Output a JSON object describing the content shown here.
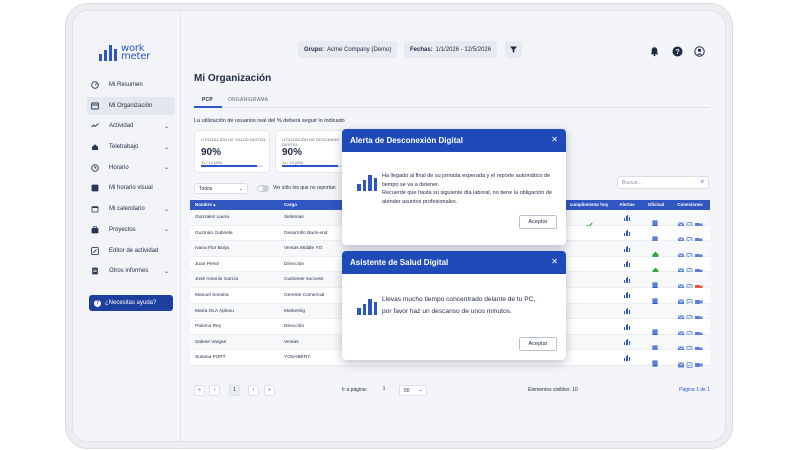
{
  "window_controls": {
    "colors": [
      "#ef5f58",
      "#f7bf2f",
      "#3ec44e"
    ]
  },
  "logo": {
    "line1": "work",
    "line2": "meter",
    "brand_color": "#2c56c4"
  },
  "sidebar": {
    "items": [
      {
        "label": "Mi Resumen",
        "icon": "dashboard-icon",
        "has_chevron": false,
        "active": false
      },
      {
        "label": "Mi Organización",
        "icon": "organization-icon",
        "has_chevron": false,
        "active": true
      },
      {
        "label": "Actividad",
        "icon": "activity-icon",
        "has_chevron": true,
        "active": false
      },
      {
        "label": "Teletrabajo",
        "icon": "telework-icon",
        "has_chevron": true,
        "active": false
      },
      {
        "label": "Horario",
        "icon": "clock-icon",
        "has_chevron": true,
        "active": false
      },
      {
        "label": "Mi horario visual",
        "icon": "visual-schedule-icon",
        "has_chevron": false,
        "active": false
      },
      {
        "label": "Mi calendario",
        "icon": "calendar-icon",
        "has_chevron": true,
        "active": false
      },
      {
        "label": "Proyectos",
        "icon": "projects-icon",
        "has_chevron": true,
        "active": false
      },
      {
        "label": "Editor de actividad",
        "icon": "edit-icon",
        "has_chevron": false,
        "active": false
      },
      {
        "label": "Otros informes",
        "icon": "reports-icon",
        "has_chevron": true,
        "active": false
      }
    ],
    "help_label": "¿Necesitas ayuda?"
  },
  "header": {
    "group_label": "Grupo:",
    "group_value": "Acme Company (Demo)",
    "dates_label": "Fechas:",
    "dates_value": "1/1/2026 - 12/5/2026",
    "icons": [
      "filter-icon",
      "notification-bell-icon",
      "help-circle-icon",
      "user-account-icon"
    ]
  },
  "main": {
    "title": "Mi Organización",
    "tabs": [
      "PCP",
      "ORGANIGRAMA"
    ],
    "active_tab": 0,
    "subtitle": "La utilización de usuarios real del % deberá seguir lo indicado",
    "stats": [
      {
        "label": "UTILIZACIÓN DE SALUD DIGITAL",
        "value": "90%",
        "sub": "11 / 12 (8%)",
        "progress": 0.9
      },
      {
        "label": "UTILIZACIÓN DE DESCANSO DIGITAL",
        "value": "90%",
        "sub": "11 / 12 (8%)",
        "progress": 0.9
      }
    ],
    "filter_select": "Todos",
    "toggle_label": "Ver sólo los que no reportan",
    "search_placeholder": "Buscar..."
  },
  "table": {
    "columns": [
      "Nombre ▴",
      "Cargo",
      "cumplimiento hoy",
      "Alertas",
      "Oficinal",
      "Conexiones"
    ],
    "header_color": "#2f56c1",
    "rows": [
      {
        "name": "Gonzalez Laura",
        "role": "Sistemas",
        "check": true,
        "oficinal": "building"
      },
      {
        "name": "Guzmán Gabriela",
        "role": "Desarrollo Back-end",
        "check": false,
        "oficinal": "building"
      },
      {
        "name": "Ivana Flor Borja",
        "role": "Ventas Middle YO",
        "check": false,
        "oficinal": "home"
      },
      {
        "name": "Juan Perez",
        "role": "Dirección",
        "check": false,
        "oficinal": "home"
      },
      {
        "name": "José Antonio García",
        "role": "Customer success",
        "check": false,
        "oficinal": "building"
      },
      {
        "name": "Manuel Soneira",
        "role": "Gerente Comercial",
        "check": false,
        "oficinal": "building"
      },
      {
        "name": "María OLA Aploou",
        "role": "Marketing",
        "check": false,
        "oficinal": "none"
      },
      {
        "name": "Paloma Rey",
        "role": "Dirección",
        "check": false,
        "oficinal": "building"
      },
      {
        "name": "Salene Vargas",
        "role": "Ventas",
        "check": false,
        "oficinal": "building"
      },
      {
        "name": "Susana FORT",
        "role": "YOSABERY",
        "check": false,
        "oficinal": "building"
      }
    ]
  },
  "pager": {
    "current_page": "1",
    "go_to_label": "Ir a página:",
    "go_to_value": "1",
    "page_size": "50",
    "visible_label": "Elementos visibles: 10",
    "page_of": "Página 1 de 1"
  },
  "dialogs": {
    "disconnect": {
      "title": "Alerta de Desconexión Digital",
      "line1": "Ha llegado al final de su jornada esperada y el reporte automático de",
      "line2": "tiempo se va a detener.",
      "line3": "Recuerde que hasta su siguiente día laboral, no tiene la obligación de",
      "line4": "atender asuntos profesionales.",
      "button": "Aceptar"
    },
    "health": {
      "title": "Asistente de Salud Digital",
      "line1": "Llevas mucho tiempo concentrado delante de tu PC,",
      "line2": "por favor haz un descanso de unos minutos.",
      "button": "Aceptar"
    }
  }
}
